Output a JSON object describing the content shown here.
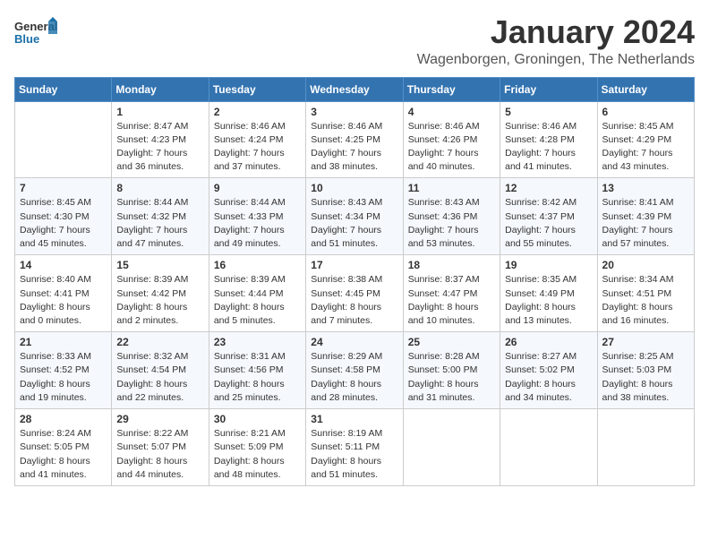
{
  "header": {
    "logo_line1": "General",
    "logo_line2": "Blue",
    "month_title": "January 2024",
    "location": "Wagenborgen, Groningen, The Netherlands"
  },
  "days_of_week": [
    "Sunday",
    "Monday",
    "Tuesday",
    "Wednesday",
    "Thursday",
    "Friday",
    "Saturday"
  ],
  "weeks": [
    [
      {
        "day": "",
        "sunrise": "",
        "sunset": "",
        "daylight": ""
      },
      {
        "day": "1",
        "sunrise": "Sunrise: 8:47 AM",
        "sunset": "Sunset: 4:23 PM",
        "daylight": "Daylight: 7 hours and 36 minutes."
      },
      {
        "day": "2",
        "sunrise": "Sunrise: 8:46 AM",
        "sunset": "Sunset: 4:24 PM",
        "daylight": "Daylight: 7 hours and 37 minutes."
      },
      {
        "day": "3",
        "sunrise": "Sunrise: 8:46 AM",
        "sunset": "Sunset: 4:25 PM",
        "daylight": "Daylight: 7 hours and 38 minutes."
      },
      {
        "day": "4",
        "sunrise": "Sunrise: 8:46 AM",
        "sunset": "Sunset: 4:26 PM",
        "daylight": "Daylight: 7 hours and 40 minutes."
      },
      {
        "day": "5",
        "sunrise": "Sunrise: 8:46 AM",
        "sunset": "Sunset: 4:28 PM",
        "daylight": "Daylight: 7 hours and 41 minutes."
      },
      {
        "day": "6",
        "sunrise": "Sunrise: 8:45 AM",
        "sunset": "Sunset: 4:29 PM",
        "daylight": "Daylight: 7 hours and 43 minutes."
      }
    ],
    [
      {
        "day": "7",
        "sunrise": "Sunrise: 8:45 AM",
        "sunset": "Sunset: 4:30 PM",
        "daylight": "Daylight: 7 hours and 45 minutes."
      },
      {
        "day": "8",
        "sunrise": "Sunrise: 8:44 AM",
        "sunset": "Sunset: 4:32 PM",
        "daylight": "Daylight: 7 hours and 47 minutes."
      },
      {
        "day": "9",
        "sunrise": "Sunrise: 8:44 AM",
        "sunset": "Sunset: 4:33 PM",
        "daylight": "Daylight: 7 hours and 49 minutes."
      },
      {
        "day": "10",
        "sunrise": "Sunrise: 8:43 AM",
        "sunset": "Sunset: 4:34 PM",
        "daylight": "Daylight: 7 hours and 51 minutes."
      },
      {
        "day": "11",
        "sunrise": "Sunrise: 8:43 AM",
        "sunset": "Sunset: 4:36 PM",
        "daylight": "Daylight: 7 hours and 53 minutes."
      },
      {
        "day": "12",
        "sunrise": "Sunrise: 8:42 AM",
        "sunset": "Sunset: 4:37 PM",
        "daylight": "Daylight: 7 hours and 55 minutes."
      },
      {
        "day": "13",
        "sunrise": "Sunrise: 8:41 AM",
        "sunset": "Sunset: 4:39 PM",
        "daylight": "Daylight: 7 hours and 57 minutes."
      }
    ],
    [
      {
        "day": "14",
        "sunrise": "Sunrise: 8:40 AM",
        "sunset": "Sunset: 4:41 PM",
        "daylight": "Daylight: 8 hours and 0 minutes."
      },
      {
        "day": "15",
        "sunrise": "Sunrise: 8:39 AM",
        "sunset": "Sunset: 4:42 PM",
        "daylight": "Daylight: 8 hours and 2 minutes."
      },
      {
        "day": "16",
        "sunrise": "Sunrise: 8:39 AM",
        "sunset": "Sunset: 4:44 PM",
        "daylight": "Daylight: 8 hours and 5 minutes."
      },
      {
        "day": "17",
        "sunrise": "Sunrise: 8:38 AM",
        "sunset": "Sunset: 4:45 PM",
        "daylight": "Daylight: 8 hours and 7 minutes."
      },
      {
        "day": "18",
        "sunrise": "Sunrise: 8:37 AM",
        "sunset": "Sunset: 4:47 PM",
        "daylight": "Daylight: 8 hours and 10 minutes."
      },
      {
        "day": "19",
        "sunrise": "Sunrise: 8:35 AM",
        "sunset": "Sunset: 4:49 PM",
        "daylight": "Daylight: 8 hours and 13 minutes."
      },
      {
        "day": "20",
        "sunrise": "Sunrise: 8:34 AM",
        "sunset": "Sunset: 4:51 PM",
        "daylight": "Daylight: 8 hours and 16 minutes."
      }
    ],
    [
      {
        "day": "21",
        "sunrise": "Sunrise: 8:33 AM",
        "sunset": "Sunset: 4:52 PM",
        "daylight": "Daylight: 8 hours and 19 minutes."
      },
      {
        "day": "22",
        "sunrise": "Sunrise: 8:32 AM",
        "sunset": "Sunset: 4:54 PM",
        "daylight": "Daylight: 8 hours and 22 minutes."
      },
      {
        "day": "23",
        "sunrise": "Sunrise: 8:31 AM",
        "sunset": "Sunset: 4:56 PM",
        "daylight": "Daylight: 8 hours and 25 minutes."
      },
      {
        "day": "24",
        "sunrise": "Sunrise: 8:29 AM",
        "sunset": "Sunset: 4:58 PM",
        "daylight": "Daylight: 8 hours and 28 minutes."
      },
      {
        "day": "25",
        "sunrise": "Sunrise: 8:28 AM",
        "sunset": "Sunset: 5:00 PM",
        "daylight": "Daylight: 8 hours and 31 minutes."
      },
      {
        "day": "26",
        "sunrise": "Sunrise: 8:27 AM",
        "sunset": "Sunset: 5:02 PM",
        "daylight": "Daylight: 8 hours and 34 minutes."
      },
      {
        "day": "27",
        "sunrise": "Sunrise: 8:25 AM",
        "sunset": "Sunset: 5:03 PM",
        "daylight": "Daylight: 8 hours and 38 minutes."
      }
    ],
    [
      {
        "day": "28",
        "sunrise": "Sunrise: 8:24 AM",
        "sunset": "Sunset: 5:05 PM",
        "daylight": "Daylight: 8 hours and 41 minutes."
      },
      {
        "day": "29",
        "sunrise": "Sunrise: 8:22 AM",
        "sunset": "Sunset: 5:07 PM",
        "daylight": "Daylight: 8 hours and 44 minutes."
      },
      {
        "day": "30",
        "sunrise": "Sunrise: 8:21 AM",
        "sunset": "Sunset: 5:09 PM",
        "daylight": "Daylight: 8 hours and 48 minutes."
      },
      {
        "day": "31",
        "sunrise": "Sunrise: 8:19 AM",
        "sunset": "Sunset: 5:11 PM",
        "daylight": "Daylight: 8 hours and 51 minutes."
      },
      {
        "day": "",
        "sunrise": "",
        "sunset": "",
        "daylight": ""
      },
      {
        "day": "",
        "sunrise": "",
        "sunset": "",
        "daylight": ""
      },
      {
        "day": "",
        "sunrise": "",
        "sunset": "",
        "daylight": ""
      }
    ]
  ]
}
